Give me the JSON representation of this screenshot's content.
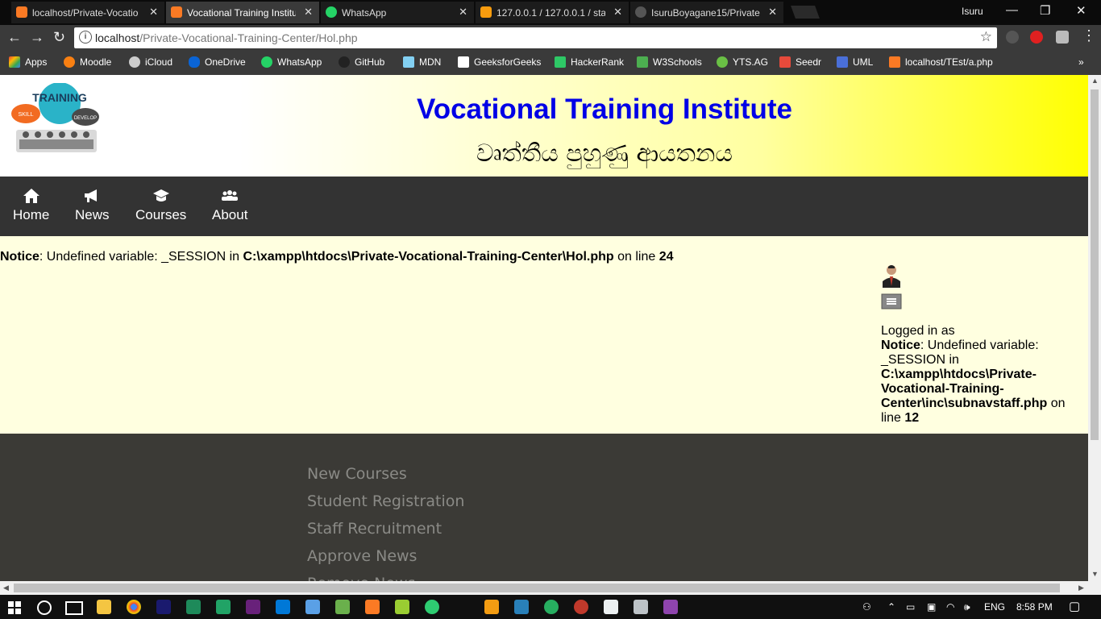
{
  "browser": {
    "tabs": [
      {
        "title": "localhost/Private-Vocatio",
        "favicon": "xampp-icon",
        "color": "#fb7a24"
      },
      {
        "title": "Vocational Training Institu",
        "favicon": "xampp-icon",
        "color": "#fb7a24",
        "active": true
      },
      {
        "title": "WhatsApp",
        "favicon": "whatsapp-icon",
        "color": "#25d366"
      },
      {
        "title": "127.0.0.1 / 127.0.0.1 / sta",
        "favicon": "phpmyadmin-icon",
        "color": "#f89c0e"
      },
      {
        "title": "IsuruBoyagane15/Private",
        "favicon": "github-icon",
        "color": "#333333"
      }
    ],
    "profile_name": "Isuru",
    "url_host": "localhost",
    "url_path": "/Private-Vocational-Training-Center/Hol.php",
    "bookmarks": [
      {
        "label": "Apps",
        "icon": "apps-grid-icon",
        "color": "#e94235"
      },
      {
        "label": "Moodle",
        "icon": "moodle-icon",
        "color": "#f98012"
      },
      {
        "label": "iCloud",
        "icon": "apple-icon",
        "color": "#cccccc"
      },
      {
        "label": "OneDrive",
        "icon": "onedrive-icon",
        "color": "#0a64d6"
      },
      {
        "label": "WhatsApp",
        "icon": "whatsapp-icon",
        "color": "#25d366"
      },
      {
        "label": "GitHub",
        "icon": "github-icon",
        "color": "#222222"
      },
      {
        "label": "MDN",
        "icon": "mdn-icon",
        "color": "#83d0f2"
      },
      {
        "label": "GeeksforGeeks",
        "icon": "gfg-icon",
        "color": "#ffffff"
      },
      {
        "label": "HackerRank",
        "icon": "hackerrank-icon",
        "color": "#2ec866"
      },
      {
        "label": "W3Schools",
        "icon": "w3schools-icon",
        "color": "#4caf50"
      },
      {
        "label": "YTS.AG",
        "icon": "yts-icon",
        "color": "#6ac045"
      },
      {
        "label": "Seedr",
        "icon": "seedr-icon",
        "color": "#e64a3b"
      },
      {
        "label": "UML",
        "icon": "uml-icon",
        "color": "#4a6fd8"
      },
      {
        "label": "localhost/TEst/a.php",
        "icon": "xampp-icon",
        "color": "#fb7a24"
      }
    ]
  },
  "site": {
    "title": "Vocational Training Institute",
    "subtitle": "වෘත්තීය පුහුණු ආයතනය",
    "logo_text": "TRAINING",
    "logo_bubbles": [
      "SKILL",
      "DEVELOP"
    ],
    "nav": [
      {
        "label": "Home",
        "icon": "home-icon"
      },
      {
        "label": "News",
        "icon": "megaphone-icon"
      },
      {
        "label": "Courses",
        "icon": "graduation-cap-icon"
      },
      {
        "label": "About",
        "icon": "users-icon"
      }
    ],
    "notice_main": {
      "label": "Notice",
      "text": ": Undefined variable: _SESSION in ",
      "path": "C:\\xampp\\htdocs\\Private-Vocational-Training-Center\\Hol.php",
      "mid": " on line ",
      "line": "24"
    },
    "side": {
      "logged_in_as": "Logged in as",
      "notice_label": "Notice",
      "notice_text": ": Undefined variable: _SESSION in ",
      "notice_path": "C:\\xampp\\htdocs\\Private-Vocational-Training-Center\\inc\\subnavstaff.php",
      "notice_mid": " on line ",
      "notice_line": "12"
    },
    "footer_links": [
      "New Courses",
      "Student Registration",
      "Staff Recruitment",
      "Approve News",
      "Remove News"
    ]
  },
  "taskbar": {
    "language": "ENG",
    "time": "8:58 PM"
  }
}
